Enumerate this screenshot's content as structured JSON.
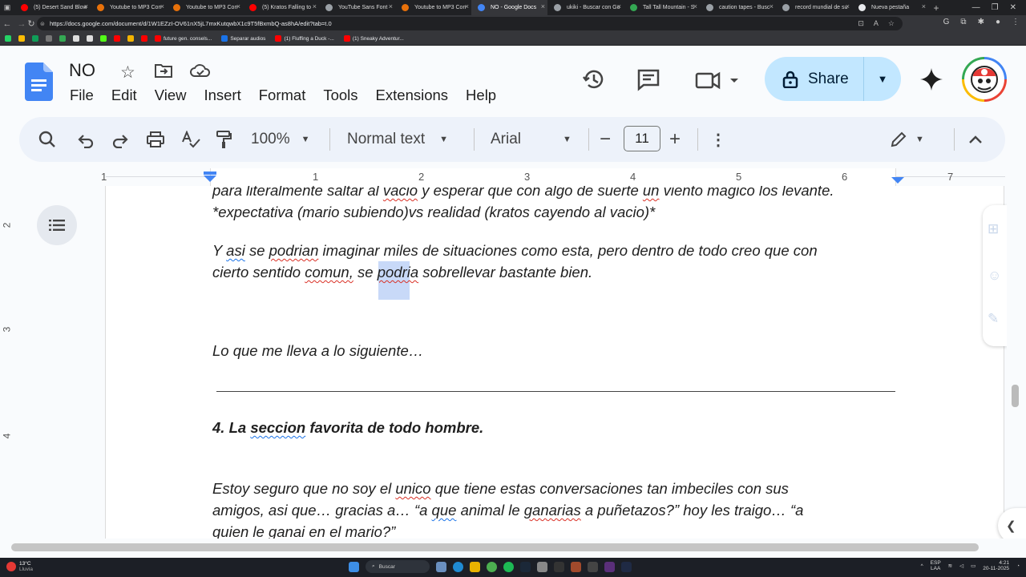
{
  "browser": {
    "tabs": [
      {
        "label": "(5) Desert Sand Blow",
        "color": "#ff0000"
      },
      {
        "label": "Youtube to MP3 Con",
        "color": "#e8710a"
      },
      {
        "label": "Youtube to MP3 Con",
        "color": "#e8710a"
      },
      {
        "label": "(5) Kratos Falling to",
        "color": "#ff0000"
      },
      {
        "label": "YouTube Sans Font",
        "color": "#9aa0a6"
      },
      {
        "label": "Youtube to MP3 Con",
        "color": "#e8710a"
      },
      {
        "label": "NO - Google Docs",
        "color": "#4285f4",
        "active": true
      },
      {
        "label": "ukiki - Buscar con Go",
        "color": "#9aa0a6"
      },
      {
        "label": "Tall Tall Mountain - S",
        "color": "#34a853"
      },
      {
        "label": "caution tapes - Busc",
        "color": "#9aa0a6"
      },
      {
        "label": "record mundial de su",
        "color": "#9aa0a6"
      },
      {
        "label": "Nueva pestaña",
        "color": "#e8eaed"
      }
    ],
    "url": "https://docs.google.com/document/d/1W1EZzI-OV61nX5jL7mxKutqwbX1c9T5fBxmbQ-as8hA/edit?tab=t.0",
    "bookmarks": [
      {
        "label": "future gen. consels...",
        "color": "#ff0000"
      },
      {
        "label": "Separar audios",
        "color": "#1a73e8"
      },
      {
        "label": "(1) Fluffing a Duck -...",
        "color": "#ff0000"
      },
      {
        "label": "(1) Sneaky Adventur...",
        "color": "#ff0000"
      }
    ]
  },
  "docs": {
    "title": "NO",
    "menu": [
      "File",
      "Edit",
      "View",
      "Insert",
      "Format",
      "Tools",
      "Extensions",
      "Help"
    ],
    "share_label": "Share",
    "zoom": "100%",
    "style": "Normal text",
    "font": "Arial",
    "font_size": "11",
    "ruler_h": [
      "1",
      "1",
      "2",
      "3",
      "4",
      "5",
      "6",
      "7"
    ],
    "ruler_v": [
      "2",
      "3",
      "4"
    ]
  },
  "content": {
    "line1": "para literalmente saltar al vacio y esperar que con algo de suerte un viento magico los levante.",
    "line2": "*expectativa (mario subiendo)vs realidad (kratos cayendo al vacio)*",
    "line3": "Y asi se podrian imaginar miles de situaciones como esta, pero dentro de todo creo que con",
    "line4": "cierto sentido comun, se podria sobrellevar bastante bien.",
    "line5": "Lo que me lleva a lo siguiente…",
    "heading": "4. La seccion favorita de todo hombre.",
    "line6": "Estoy seguro que no soy el unico que tiene estas conversaciones tan imbeciles con sus",
    "line7": "amigos, asi que… gracias a… “a que animal le ganarias a puñetazos?” hoy les traigo… “a",
    "line8": "quien le ganai en el mario?”"
  },
  "taskbar": {
    "temp": "13°C",
    "weather": "Lluvia",
    "search": "Buscar",
    "lang1": "ESP",
    "lang2": "LAA",
    "time": "4:21",
    "date": "20-11-2025"
  },
  "colors": {
    "accent": "#c2e7ff",
    "docs_blue": "#4285f4",
    "selection": "#c2d5f7"
  }
}
